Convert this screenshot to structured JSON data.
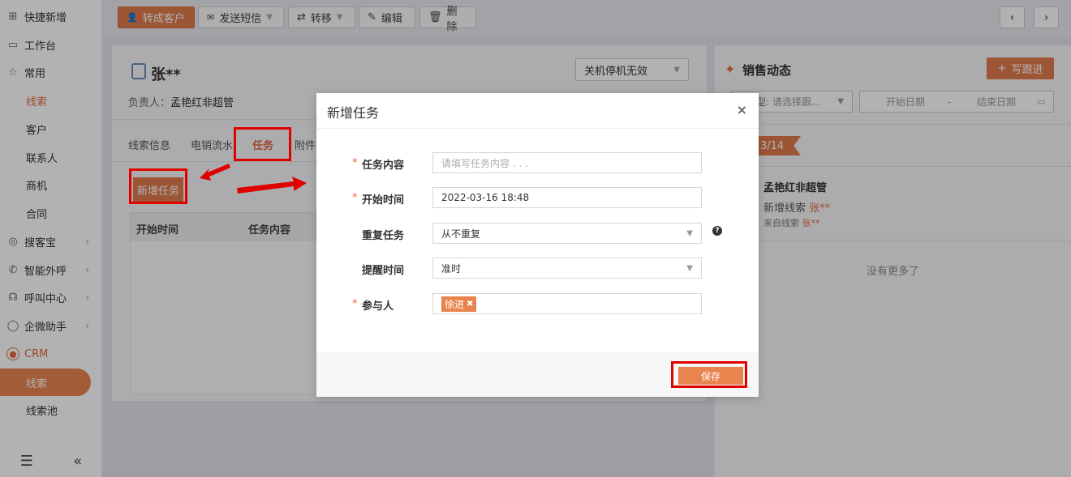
{
  "sidebar": {
    "items": [
      {
        "label": "快捷新增",
        "icon": "plus-square-icon"
      },
      {
        "label": "工作台",
        "icon": "monitor-icon"
      },
      {
        "label": "常用",
        "icon": "star-icon"
      },
      {
        "label": "线索"
      },
      {
        "label": "客户"
      },
      {
        "label": "联系人"
      },
      {
        "label": "商机"
      },
      {
        "label": "合同"
      },
      {
        "label": "搜客宝",
        "icon": "search-circle-icon"
      },
      {
        "label": "智能外呼",
        "icon": "phone-icon"
      },
      {
        "label": "呼叫中心",
        "icon": "headset-icon"
      },
      {
        "label": "企微助手",
        "icon": "chat-icon"
      },
      {
        "label": "CRM",
        "icon": "crm-icon"
      },
      {
        "label": "线索"
      },
      {
        "label": "线索池"
      }
    ]
  },
  "toolbar": {
    "convert": "转成客户",
    "sms": "发送短信",
    "transfer": "转移",
    "edit": "编辑",
    "delete": "删除"
  },
  "lead": {
    "name": "张**",
    "owner_label": "负责人：",
    "owner": "孟艳红非超管",
    "status": "关机停机无效"
  },
  "tabs": [
    "线索信息",
    "电销流水",
    "任务",
    "附件"
  ],
  "task_panel": {
    "add_button": "新增任务",
    "columns": [
      "开始时间",
      "任务内容"
    ]
  },
  "sales": {
    "title": "销售动态",
    "write_button": "写跟进",
    "type_label": "型:",
    "type_placeholder": "请选择跟...",
    "start_date": "开始日期",
    "range_sep": "-",
    "end_date": "结束日期",
    "date_tag": "3/14",
    "feed_author": "孟艳红非超管",
    "feed_action_prefix": "新增线索 ",
    "feed_action_name": "张**",
    "feed_from_prefix": "来自线索 ",
    "feed_from_name": "张**",
    "no_more": "没有更多了"
  },
  "modal": {
    "title": "新增任务",
    "close": "×",
    "fields": {
      "content_label": "任务内容",
      "content_placeholder": "请填写任务内容 . . .",
      "start_label": "开始时间",
      "start_value": "2022-03-16 18:48",
      "repeat_label": "重复任务",
      "repeat_value": "从不重复",
      "remind_label": "提醒时间",
      "remind_value": "准时",
      "participant_label": "参与人",
      "participant_tag": "徐进"
    },
    "required_mark": "*",
    "help": "?",
    "save": "保存"
  },
  "colors": {
    "accent": "#e9844f",
    "highlight": "#e00000"
  }
}
